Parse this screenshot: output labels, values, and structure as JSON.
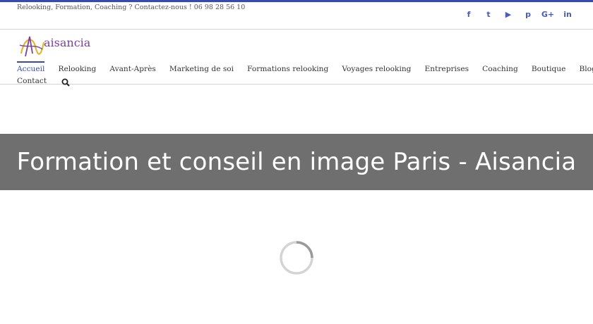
{
  "topbar": {
    "tagline": "Relooking, Formation, Coaching ? Contactez-nous ! 06 98 28 56 10",
    "social": [
      {
        "icon": "facebook-icon",
        "glyph": "f"
      },
      {
        "icon": "twitter-icon",
        "glyph": "t"
      },
      {
        "icon": "youtube-icon",
        "glyph": "▶"
      },
      {
        "icon": "pinterest-icon",
        "glyph": "p"
      },
      {
        "icon": "google-plus-icon",
        "glyph": "G+"
      },
      {
        "icon": "linkedin-icon",
        "glyph": "in"
      }
    ]
  },
  "logo": {
    "text": "aisancia"
  },
  "nav": {
    "items": [
      "Accueil",
      "Relooking",
      "Avant-Après",
      "Marketing de soi",
      "Formations relooking",
      "Voyages relooking",
      "Entreprises",
      "Coaching",
      "Boutique",
      "Blog",
      "Contact"
    ],
    "active": "Accueil"
  },
  "banner": {
    "title": "Formation et conseil en image Paris - Aisancia"
  },
  "colors": {
    "accent": "#3b4aa6",
    "divider": "#ecd970",
    "banner_bg": "#6f6f6f",
    "logo": "#7d3fa0",
    "spinner": "#c8c8c8"
  }
}
